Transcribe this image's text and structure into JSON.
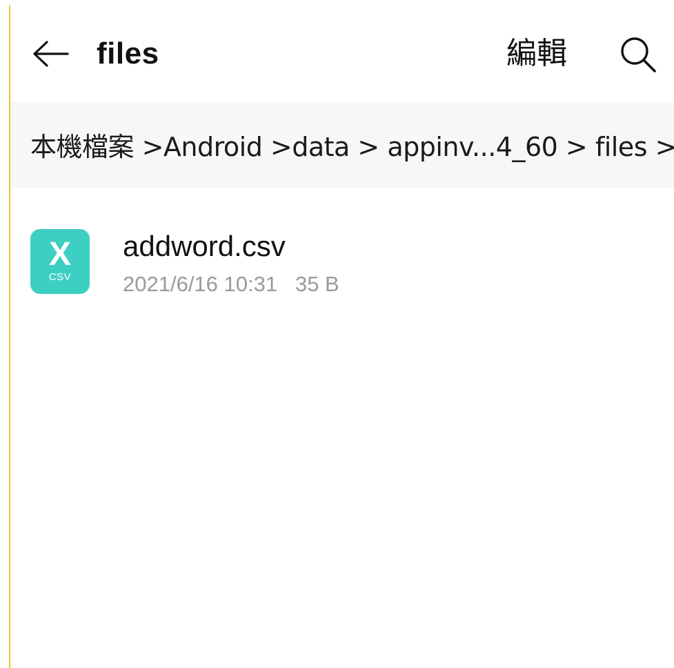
{
  "header": {
    "back_icon": "arrow-left-icon",
    "title": "files",
    "edit_label": "編輯",
    "search_icon": "search-icon"
  },
  "breadcrumb": {
    "path": "本機檔案 >Android >data > appinv...4_60 > files >"
  },
  "files": [
    {
      "name": "addword.csv",
      "icon": "csv-file-icon",
      "icon_glyph": "X",
      "icon_ext": "CSV",
      "icon_color": "#3ecfc3",
      "date": "2021/6/16 10:31",
      "size": "35 B"
    }
  ],
  "colors": {
    "frame_border": "#f3c623",
    "breadcrumb_bg": "#f7f7f7",
    "meta_text": "#9a9a9a"
  }
}
